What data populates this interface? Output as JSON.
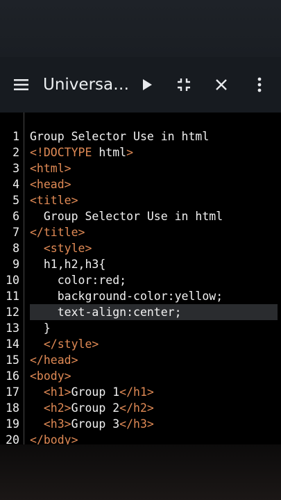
{
  "toolbar": {
    "title": "Universa…",
    "icons": [
      "menu-icon",
      "play-icon",
      "collapse-icon",
      "close-icon",
      "more-vertical-icon"
    ]
  },
  "colors": {
    "tag": "#e08a55",
    "text": "#f2f2f2",
    "toolbar_bg": "#171b20",
    "editor_bg": "#000000",
    "active_line": "#2a2c2f"
  },
  "editor": {
    "active_line": 12,
    "lines": [
      {
        "num": "1",
        "segments": [
          {
            "text": "Group Selector Use in html",
            "kind": "plain"
          }
        ]
      },
      {
        "num": "2",
        "segments": [
          {
            "text": "<!DOCTYPE",
            "kind": "tag"
          },
          {
            "text": " html",
            "kind": "plain"
          },
          {
            "text": ">",
            "kind": "tag"
          }
        ]
      },
      {
        "num": "3",
        "segments": [
          {
            "text": "<html>",
            "kind": "tag"
          }
        ]
      },
      {
        "num": "4",
        "segments": [
          {
            "text": "<head>",
            "kind": "tag"
          }
        ]
      },
      {
        "num": "5",
        "segments": [
          {
            "text": "<title>",
            "kind": "tag"
          }
        ]
      },
      {
        "num": "6",
        "segments": [
          {
            "text": "  Group Selector Use in html",
            "kind": "plain"
          }
        ]
      },
      {
        "num": "7",
        "segments": [
          {
            "text": "</title>",
            "kind": "tag"
          }
        ]
      },
      {
        "num": "8",
        "segments": [
          {
            "text": "  ",
            "kind": "plain"
          },
          {
            "text": "<style>",
            "kind": "tag"
          }
        ]
      },
      {
        "num": "9",
        "segments": [
          {
            "text": "  h1,h2,h3{",
            "kind": "plain"
          }
        ]
      },
      {
        "num": "10",
        "segments": [
          {
            "text": "    color:red;",
            "kind": "plain"
          }
        ]
      },
      {
        "num": "11",
        "segments": [
          {
            "text": "    background-color:yellow;",
            "kind": "plain"
          }
        ]
      },
      {
        "num": "12",
        "segments": [
          {
            "text": "    text-align:center;",
            "kind": "plain"
          }
        ]
      },
      {
        "num": "13",
        "segments": [
          {
            "text": "  }",
            "kind": "plain"
          }
        ]
      },
      {
        "num": "14",
        "segments": [
          {
            "text": "  ",
            "kind": "plain"
          },
          {
            "text": "</style>",
            "kind": "tag"
          }
        ]
      },
      {
        "num": "15",
        "segments": [
          {
            "text": "</head>",
            "kind": "tag"
          }
        ]
      },
      {
        "num": "16",
        "segments": [
          {
            "text": "<body>",
            "kind": "tag"
          }
        ]
      },
      {
        "num": "17",
        "segments": [
          {
            "text": "  ",
            "kind": "plain"
          },
          {
            "text": "<h1>",
            "kind": "tag"
          },
          {
            "text": "Group 1",
            "kind": "plain"
          },
          {
            "text": "</h1>",
            "kind": "tag"
          }
        ]
      },
      {
        "num": "18",
        "segments": [
          {
            "text": "  ",
            "kind": "plain"
          },
          {
            "text": "<h2>",
            "kind": "tag"
          },
          {
            "text": "Group 2",
            "kind": "plain"
          },
          {
            "text": "</h2>",
            "kind": "tag"
          }
        ]
      },
      {
        "num": "19",
        "segments": [
          {
            "text": "  ",
            "kind": "plain"
          },
          {
            "text": "<h3>",
            "kind": "tag"
          },
          {
            "text": "Group 3",
            "kind": "plain"
          },
          {
            "text": "</h3>",
            "kind": "tag"
          }
        ]
      },
      {
        "num": "20",
        "segments": [
          {
            "text": "</body>",
            "kind": "tag"
          }
        ]
      }
    ]
  }
}
